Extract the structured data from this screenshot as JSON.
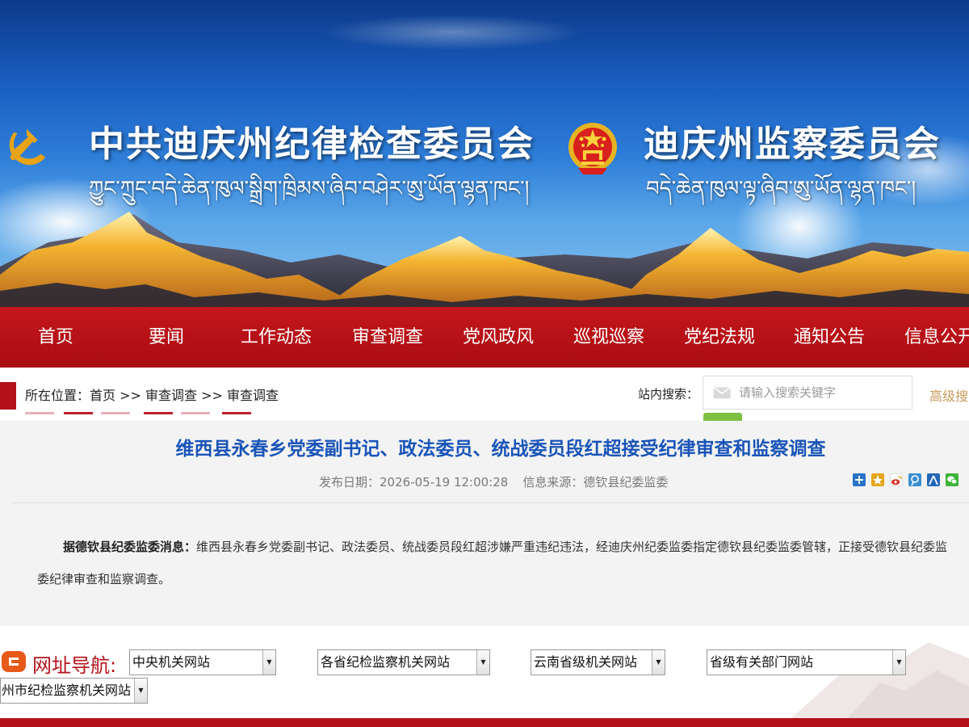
{
  "header": {
    "title_left": "中共迪庆州纪律检查委员会",
    "title_left_tibetan": "ཀྱུང་ཀྲུང་བདེ་ཆེན་ཁུལ་སྒྲིག་ཁྲིམས་ཞིབ་བཤེར་ཨུ་ཡོན་ལྷན་ཁང་།",
    "title_right": "迪庆州监察委员会",
    "title_right_tibetan": "བདེ་ཆེན་ཁུལ་ལྟ་ཞིབ་ཨུ་ཡོན་ལྷན་ཁང་།"
  },
  "nav": {
    "items": [
      "首页",
      "要闻",
      "工作动态",
      "审查调查",
      "党风政风",
      "巡视巡察",
      "党纪法规",
      "通知公告",
      "信息公开"
    ]
  },
  "breadcrumb": {
    "prefix": "所在位置：",
    "items": [
      "首页",
      ">>",
      "审查调查",
      ">>",
      "审查调查"
    ]
  },
  "search": {
    "label": "站内搜索：",
    "placeholder": "请输入搜索关键字",
    "advanced": "高级搜"
  },
  "article": {
    "title": "维西县永春乡党委副书记、政法委员、统战委员段红超接受纪律审查和监察调查",
    "date_label": "发布日期：",
    "date": "2026-05-19 12:00:28",
    "source_label": "信息来源：",
    "source": "德钦县纪委监委",
    "body_lead": "据德钦县纪委监委消息：",
    "body": "维西县永春乡党委副书记、政法委员、统战委员段红超涉嫌严重违纪违法，经迪庆州纪委监委指定德钦县纪委监委管辖，正接受德钦县纪委监委纪律审查和监察调查。"
  },
  "share": {
    "icons": [
      "share-plus-icon",
      "qzone-icon",
      "weibo-icon",
      "tencent-weibo-icon",
      "renren-icon",
      "wechat-icon"
    ],
    "colors": [
      "#2a73c9",
      "#e6a51b",
      "#d9332a",
      "#3a8fd0",
      "#2467b8",
      "#3db339"
    ]
  },
  "link_nav": {
    "title": "网址导航:",
    "selects": [
      "中央机关网站",
      "各省纪检监察机关网站",
      "云南省级机关网站",
      "省级有关部门网站",
      "州市纪检监察机关网站"
    ]
  },
  "colors": {
    "brand_red": "#b4121b",
    "nav_red": "#c4161c",
    "title_blue": "#1954b8",
    "search_green": "#7cc043"
  }
}
